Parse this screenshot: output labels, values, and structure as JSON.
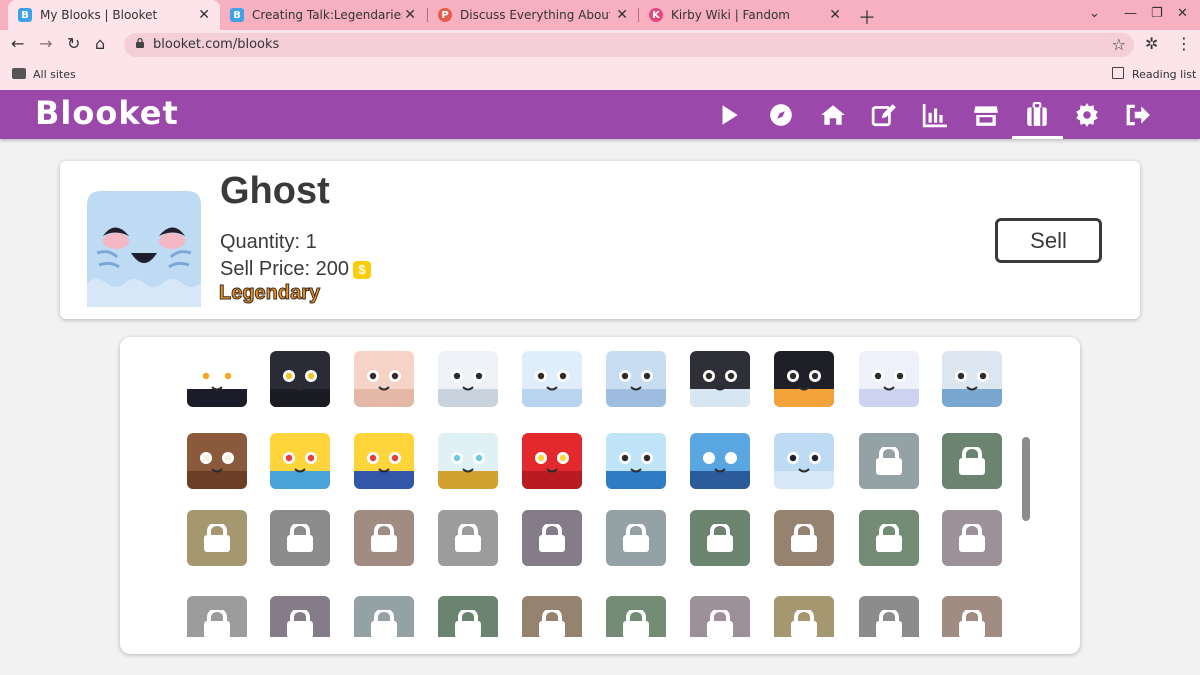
{
  "browser": {
    "tabs": [
      {
        "title": "My Blooks | Blooket",
        "favicon": "B",
        "favicon_color": "#3fa2e6"
      },
      {
        "title": "Creating Talk:Legendaries | Blooket",
        "favicon": "B",
        "favicon_color": "#3fa2e6"
      },
      {
        "title": "Discuss Everything About Prodigy",
        "favicon": "P",
        "favicon_color": "#e85c4a"
      },
      {
        "title": "Kirby Wiki | Fandom",
        "favicon": "K",
        "favicon_color": "#e6477e"
      }
    ],
    "url": "blooket.com/blooks",
    "bookmarks_label": "All sites",
    "reading_list_label": "Reading list"
  },
  "app": {
    "logo": "Blooket",
    "nav_icons": [
      "play-icon",
      "compass-icon",
      "home-icon",
      "edit-icon",
      "stats-icon",
      "market-icon",
      "blooks-icon",
      "settings-icon",
      "logout-icon"
    ],
    "active_nav": "blooks-icon",
    "accent_color": "#9a49aa"
  },
  "selected_blook": {
    "name": "Ghost",
    "quantity_label": "Quantity: 1",
    "sell_price_label": "Sell Price: 200",
    "coin_symbol": "$",
    "rarity": "Legendary",
    "rarity_color": "#ff910f",
    "sell_button": "Sell"
  },
  "blook_grid": {
    "rows": [
      [
        "toucan",
        "panther",
        "alpaca",
        "snowy-owl",
        "polar-bear",
        "arctic-wolf",
        "baby-penguin",
        "penguin",
        "arctic-hare",
        "seal"
      ],
      [
        "walrus",
        "chick-king",
        "golden-king",
        "slime-tablet",
        "red-robot",
        "whale",
        "shark",
        "ghost",
        "locked",
        "locked"
      ],
      [
        "locked",
        "locked",
        "locked",
        "locked",
        "locked",
        "locked",
        "locked",
        "locked",
        "locked",
        "locked"
      ],
      [
        "locked",
        "locked",
        "locked",
        "locked",
        "locked",
        "locked",
        "locked",
        "locked",
        "locked",
        "locked"
      ]
    ]
  }
}
